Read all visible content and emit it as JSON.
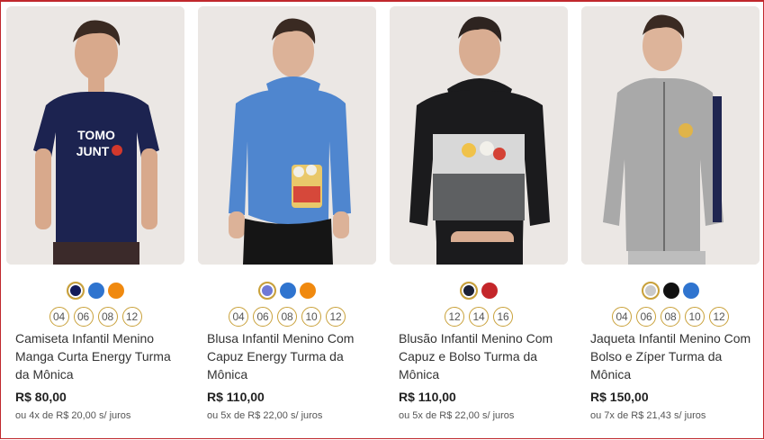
{
  "products": [
    {
      "name": "Camiseta Infantil Menino Manga Curta Energy Turma da Mônica",
      "price": "R$ 80,00",
      "installments": "ou 4x de R$ 20,00 s/ juros",
      "colors": [
        "#121a5a",
        "#2f74cf",
        "#f0890f"
      ],
      "sizes": [
        "04",
        "06",
        "08",
        "12"
      ],
      "image": {
        "shirt": "#1c2350",
        "pants": "#3b2a2a",
        "print": "TOMO JUNTO"
      }
    },
    {
      "name": "Blusa Infantil Menino Com Capuz Energy Turma da Mônica",
      "price": "R$ 110,00",
      "installments": "ou 5x de R$ 22,00 s/ juros",
      "colors": [
        "#6f79d6",
        "#2f74cf",
        "#f0890f"
      ],
      "sizes": [
        "04",
        "06",
        "08",
        "10",
        "12"
      ],
      "image": {
        "shirt": "#4f86cf",
        "pants": "#151515",
        "print": ""
      }
    },
    {
      "name": "Blusão Infantil Menino Com Capuz e Bolso Turma da Mônica",
      "price": "R$ 110,00",
      "installments": "ou 5x de R$ 22,00 s/ juros",
      "colors": [
        "#1a2035",
        "#c4262a"
      ],
      "sizes": [
        "12",
        "14",
        "16"
      ],
      "image": {
        "shirt": "#1b1b1d",
        "pants": "#1b1b1d",
        "print": ""
      }
    },
    {
      "name": "Jaqueta Infantil Menino Com Bolso e Zíper Turma da Mônica",
      "price": "R$ 150,00",
      "installments": "ou 7x de R$ 21,43 s/ juros",
      "colors": [
        "#c9c9c9",
        "#111111",
        "#2f74cf"
      ],
      "sizes": [
        "04",
        "06",
        "08",
        "10",
        "12"
      ],
      "image": {
        "shirt": "#a9a9a9",
        "pants": "#bdbdbd",
        "print": ""
      }
    }
  ]
}
